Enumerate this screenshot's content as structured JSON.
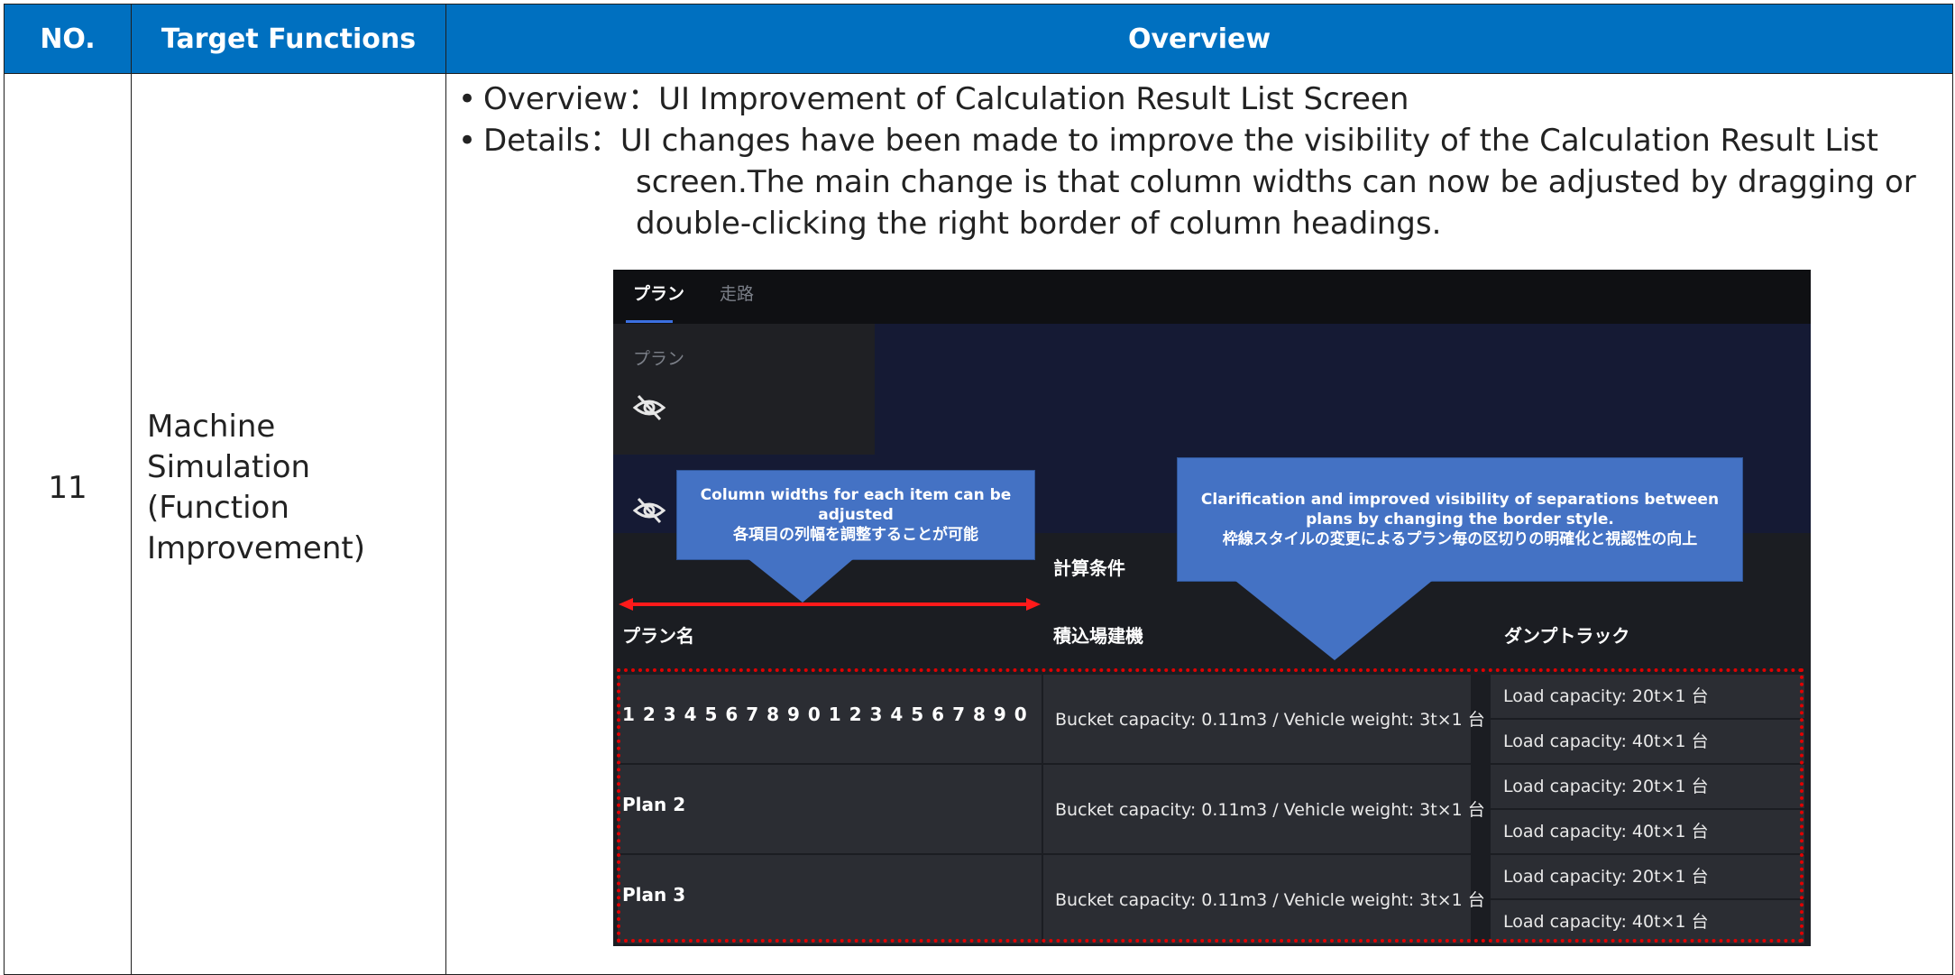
{
  "table": {
    "headers": {
      "no": "NO.",
      "target_functions": "Target Functions",
      "overview": "Overview"
    },
    "row": {
      "no": "11",
      "target_function_lines": [
        "Machine",
        "Simulation",
        "(Function",
        "Improvement)"
      ],
      "overview_line1": "Overview：UI Improvement of Calculation Result List Screen",
      "details_line1": "Details：UI changes have been made to improve the visibility of the Calculation Result List",
      "details_line2": "screen.The main change is that column widths can now be adjusted by dragging or",
      "details_line3": "double-clicking the right border of column headings."
    }
  },
  "screenshot": {
    "tabs": [
      "プラン",
      "走路"
    ],
    "active_tab": "プラン",
    "panel_label": "プラン",
    "group_header": "計算条件",
    "columns": [
      "プラン名",
      "積込場建機",
      "ダンプトラック"
    ],
    "rows": [
      {
        "plan": "1 2 3 4 5 6 7 8 9 0 1 2 3 4 5 6 7 8 9 0",
        "loader": "Bucket capacity: 0.11m3 / Vehicle weight: 3t×1 台",
        "trucks": [
          "Load capacity: 20t×1 台",
          "Load capacity: 40t×1 台"
        ]
      },
      {
        "plan": "Plan 2",
        "loader": "Bucket capacity: 0.11m3 / Vehicle weight: 3t×1 台",
        "trucks": [
          "Load capacity: 20t×1 台",
          "Load capacity: 40t×1 台"
        ]
      },
      {
        "plan": "Plan 3",
        "loader": "Bucket capacity: 0.11m3 / Vehicle weight: 3t×1 台",
        "trucks": [
          "Load capacity: 20t×1 台",
          "Load capacity: 40t×1 台"
        ]
      }
    ],
    "callout_left": {
      "line1": "Column widths for each item can be adjusted",
      "line2": "各項目の列幅を調整することが可能"
    },
    "callout_right": {
      "line1": "Clarification and improved visibility of separations between",
      "line2": "plans by changing the border style.",
      "line3": "枠線スタイルの変更によるプラン毎の区切りの明確化と視認性の向上"
    },
    "icons": [
      "eye-off-icon",
      "eye-off-icon"
    ],
    "colors": {
      "header_blue": "#0070C0",
      "callout_blue": "#4472C4",
      "highlight_red": "#e00000",
      "active_tab_underline": "#3b6fe0"
    }
  }
}
